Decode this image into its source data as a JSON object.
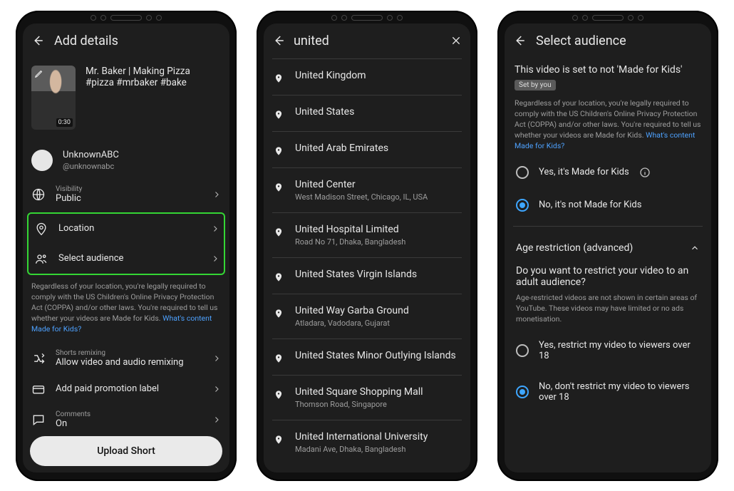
{
  "screen1": {
    "header_title": "Add details",
    "thumb_duration": "0:30",
    "caption_line1": "Mr. Baker | Making Pizza",
    "caption_line2": "#pizza #mrbaker #bake",
    "account_name": "UnknownABC",
    "account_handle": "@unknownabc",
    "visibility_label": "Visibility",
    "visibility_value": "Public",
    "location_label": "Location",
    "audience_label": "Select audience",
    "legal_text": "Regardless of your location, you're legally required to comply with the US Children's Online Privacy Protection Act (COPPA) and/or other laws. You're required to tell us whether your videos are Made for Kids. ",
    "legal_link": "What's content Made for Kids?",
    "remix_label": "Shorts remixing",
    "remix_value": "Allow video and audio remixing",
    "paid_label": "Add paid promotion label",
    "comments_label": "Comments",
    "comments_value": "On",
    "upload_btn": "Upload Short"
  },
  "screen2": {
    "query": "united",
    "results": [
      {
        "name": "United Kingdom",
        "addr": ""
      },
      {
        "name": "United States",
        "addr": ""
      },
      {
        "name": "United Arab Emirates",
        "addr": ""
      },
      {
        "name": "United Center",
        "addr": "West Madison Street, Chicago, IL, USA"
      },
      {
        "name": "United Hospital Limited",
        "addr": "Road No 71, Dhaka, Bangladesh"
      },
      {
        "name": "United States Virgin Islands",
        "addr": ""
      },
      {
        "name": "United Way Garba Ground",
        "addr": "Atladara, Vadodara, Gujarat"
      },
      {
        "name": "United States Minor Outlying Islands",
        "addr": ""
      },
      {
        "name": "United Square Shopping Mall",
        "addr": "Thomson Road, Singapore"
      },
      {
        "name": "United International University",
        "addr": "Madani Ave, Dhaka, Bangladesh"
      }
    ]
  },
  "screen3": {
    "header_title": "Select audience",
    "status_text": "This video is set to not 'Made for Kids'",
    "chip_text": "Set by you",
    "legal_text": "Regardless of your location, you're legally required to comply with the US Children's Online Privacy Protection Act (COPPA) and/or other laws. You're required to tell us whether your videos are Made for Kids. ",
    "legal_link": "What's content Made for Kids?",
    "opt_yes_kids": "Yes, it's Made for Kids",
    "opt_no_kids": "No, it's not Made for Kids",
    "section_title": "Age restriction (advanced)",
    "question": "Do you want to restrict your video to an adult audience?",
    "note": "Age-restricted videos are not shown in certain areas of YouTube. These videos may have limited or no ads monetisation.",
    "opt_yes_age": "Yes, restrict my video to viewers over 18",
    "opt_no_age": "No, don't restrict my video to viewers over 18"
  }
}
